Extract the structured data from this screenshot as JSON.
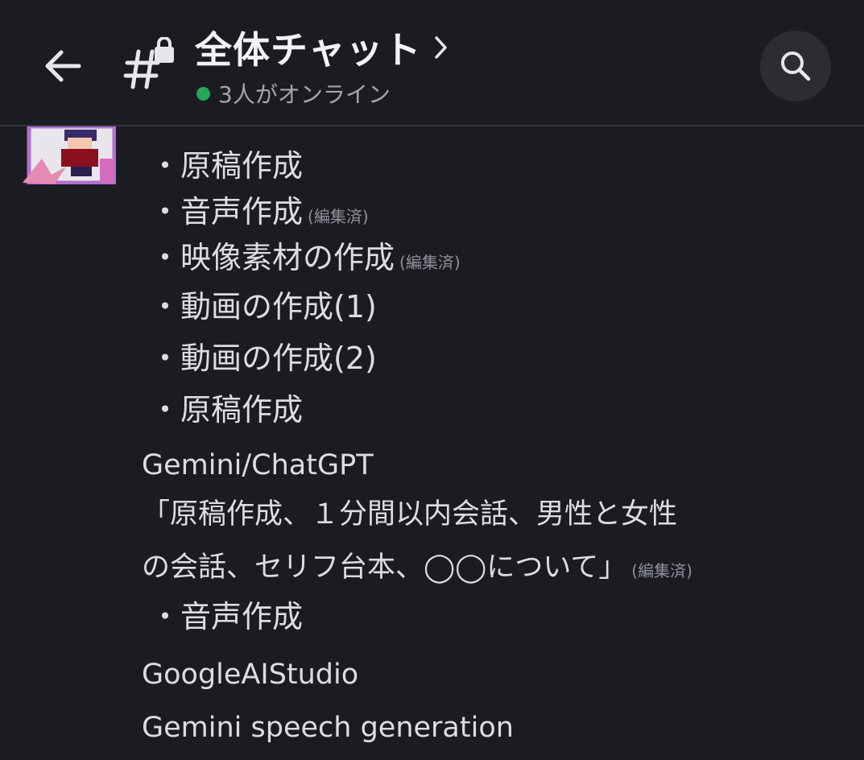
{
  "header": {
    "back_label": "back",
    "title": "全体チャット",
    "online_status": "3人がオンライン",
    "online_color": "#23a55a",
    "icons": [
      "arrow-left-icon",
      "locked-channel-hash-icon",
      "chevron-right-icon",
      "search-icon"
    ]
  },
  "message": {
    "lines": [
      {
        "text": "・原稿作成",
        "edited": ""
      },
      {
        "text": "・音声作成",
        "edited": "(編集済)"
      },
      {
        "text": "・映像素材の作成",
        "edited": "(編集済)"
      },
      {
        "text": "・動画の作成(1)",
        "edited": ""
      },
      {
        "text": "・動画の作成(2)",
        "edited": ""
      },
      {
        "text": "・原稿作成",
        "edited": ""
      },
      {
        "text": "Gemini/ChatGPT",
        "edited": ""
      },
      {
        "text": "「原稿作成、１分間以内会話、男性と女性",
        "edited": ""
      },
      {
        "text": "の会話、セリフ台本、◯◯について」",
        "edited": "(編集済)"
      },
      {
        "text": "・音声作成",
        "edited": ""
      },
      {
        "text": "GoogleAIStudio",
        "edited": ""
      },
      {
        "text": "Gemini speech generation",
        "edited": ""
      }
    ]
  }
}
